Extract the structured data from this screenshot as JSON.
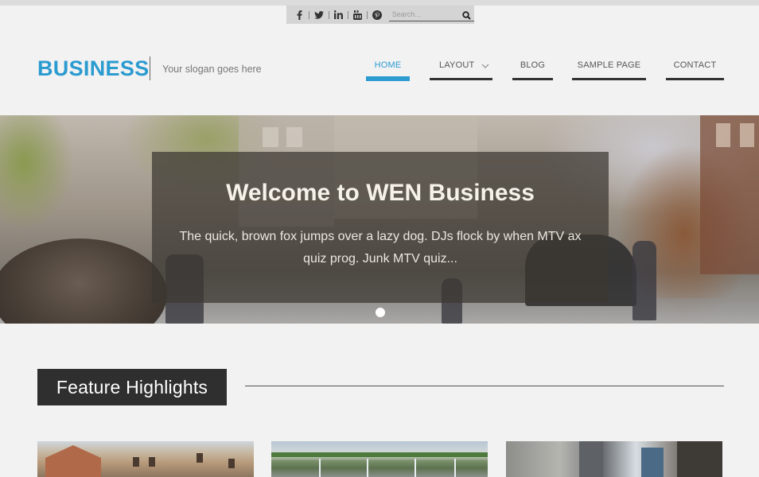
{
  "topbar": {
    "social_icons": [
      {
        "icon": "facebook-icon",
        "glyph": "f"
      },
      {
        "icon": "twitter-icon",
        "glyph": "t"
      },
      {
        "icon": "linkedin-icon",
        "glyph": "in"
      },
      {
        "icon": "youtube-icon",
        "glyph": "yt"
      },
      {
        "icon": "pinterest-icon",
        "glyph": "p"
      }
    ],
    "search": {
      "placeholder": "Search..."
    }
  },
  "header": {
    "logo": "BUSINESS",
    "slogan": "Your slogan goes here"
  },
  "nav": {
    "items": [
      {
        "label": "HOME",
        "active": true
      },
      {
        "label": "LAYOUT",
        "has_dropdown": true
      },
      {
        "label": "BLOG"
      },
      {
        "label": "SAMPLE PAGE"
      },
      {
        "label": "CONTACT"
      }
    ]
  },
  "hero": {
    "title": "Welcome to WEN Business",
    "text": "The quick, brown fox jumps over a lazy dog. DJs flock by when MTV ax quiz prog. Junk MTV quiz...",
    "slides": 1,
    "active_slide": 0
  },
  "features": {
    "title": "Feature Highlights"
  },
  "colors": {
    "accent": "#2b9bd0",
    "dark": "#2f2f2f",
    "background": "#f3f2f3"
  }
}
